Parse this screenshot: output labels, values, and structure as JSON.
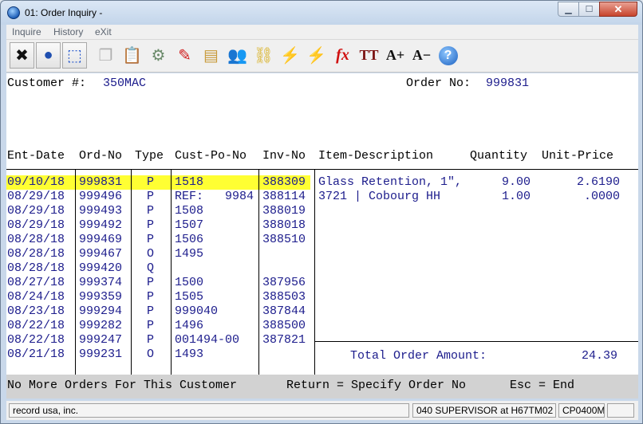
{
  "window": {
    "title": "01: Order Inquiry -"
  },
  "menu": [
    "Inquire",
    "History",
    "eXit"
  ],
  "toolbar": [
    {
      "icon": "close-x-icon",
      "glyph": "✖",
      "color": "#111111"
    },
    {
      "icon": "globe-icon",
      "glyph": "●",
      "color": "#1f4fb0"
    },
    {
      "icon": "select-area-icon",
      "glyph": "⬚",
      "color": "#2255cc"
    },
    {
      "icon": "copy-icon",
      "glyph": "❐",
      "color": "#b0b0b0"
    },
    {
      "icon": "paste-icon",
      "glyph": "📋",
      "color": "#9a9a9a"
    },
    {
      "icon": "settings-gear-icon",
      "glyph": "⚙",
      "color": "#6a8a6a"
    },
    {
      "icon": "edit-pencil-icon",
      "glyph": "✎",
      "color": "#d02020"
    },
    {
      "icon": "notes-icon",
      "glyph": "▤",
      "color": "#c89a3a"
    },
    {
      "icon": "users-icon",
      "glyph": "👥",
      "color": "#3a8ad0"
    },
    {
      "icon": "link-chain-icon",
      "glyph": "⛓",
      "color": "#d8b020"
    },
    {
      "icon": "lightning-icon",
      "glyph": "⚡",
      "color": "#e8c000"
    },
    {
      "icon": "run-script-icon",
      "glyph": "⚡",
      "color": "#e8c000"
    },
    {
      "icon": "function-fx-icon",
      "glyph": "fx",
      "color": "#d01010"
    },
    {
      "icon": "font-style-icon",
      "glyph": "TT",
      "color": "#7a1010"
    },
    {
      "icon": "increase-font-icon",
      "glyph": "A+",
      "color": "#111111"
    },
    {
      "icon": "decrease-font-icon",
      "glyph": "A−",
      "color": "#111111"
    },
    {
      "icon": "help-icon",
      "glyph": "?",
      "color": "#ffffff"
    }
  ],
  "header": {
    "customer_label": "Customer #:",
    "customer_value": "350MAC",
    "order_label": "Order No:",
    "order_value": "999831"
  },
  "columns": [
    "Ent-Date",
    "Ord-No",
    "Type",
    "Cust-Po-No",
    "Inv-No",
    "Item-Description",
    "Quantity",
    "Unit-Price"
  ],
  "orders": [
    {
      "date": "09/10/18",
      "ord": "999831",
      "type": "P",
      "po": "1518",
      "inv": "388309"
    },
    {
      "date": "08/29/18",
      "ord": "999496",
      "type": "P",
      "po": "REF:   9984",
      "inv": "388114"
    },
    {
      "date": "08/29/18",
      "ord": "999493",
      "type": "P",
      "po": "1508",
      "inv": "388019"
    },
    {
      "date": "08/29/18",
      "ord": "999492",
      "type": "P",
      "po": "1507",
      "inv": "388018"
    },
    {
      "date": "08/28/18",
      "ord": "999469",
      "type": "P",
      "po": "1506",
      "inv": "388510"
    },
    {
      "date": "08/28/18",
      "ord": "999467",
      "type": "O",
      "po": "1495",
      "inv": ""
    },
    {
      "date": "08/28/18",
      "ord": "999420",
      "type": "Q",
      "po": "",
      "inv": ""
    },
    {
      "date": "08/27/18",
      "ord": "999374",
      "type": "P",
      "po": "1500",
      "inv": "387956"
    },
    {
      "date": "08/24/18",
      "ord": "999359",
      "type": "P",
      "po": "1505",
      "inv": "388503"
    },
    {
      "date": "08/23/18",
      "ord": "999294",
      "type": "P",
      "po": "999040",
      "inv": "387844"
    },
    {
      "date": "08/22/18",
      "ord": "999282",
      "type": "P",
      "po": "1496",
      "inv": "388500"
    },
    {
      "date": "08/22/18",
      "ord": "999247",
      "type": "P",
      "po": "001494-00",
      "inv": "387821"
    },
    {
      "date": "08/21/18",
      "ord": "999231",
      "type": "O",
      "po": "1493",
      "inv": ""
    }
  ],
  "items": [
    {
      "desc": "Glass Retention, 1\",",
      "qty": "9.00",
      "price": "2.6190"
    },
    {
      "desc": "3721 | Cobourg HH",
      "qty": "1.00",
      "price": ".0000"
    }
  ],
  "total": {
    "label": "Total Order Amount:",
    "value": "24.39"
  },
  "footer": {
    "msg": "No More Orders For This Customer",
    "return_hint": "Return = Specify Order No",
    "esc_hint": "Esc = End"
  },
  "status": {
    "company": "record usa, inc.",
    "user": "040 SUPERVISOR at H67TM02",
    "program": "CP0400M"
  },
  "colors": {
    "highlight": "#ffff33",
    "data_text": "#1c1c8c",
    "footer_bg": "#d2d2d2"
  }
}
